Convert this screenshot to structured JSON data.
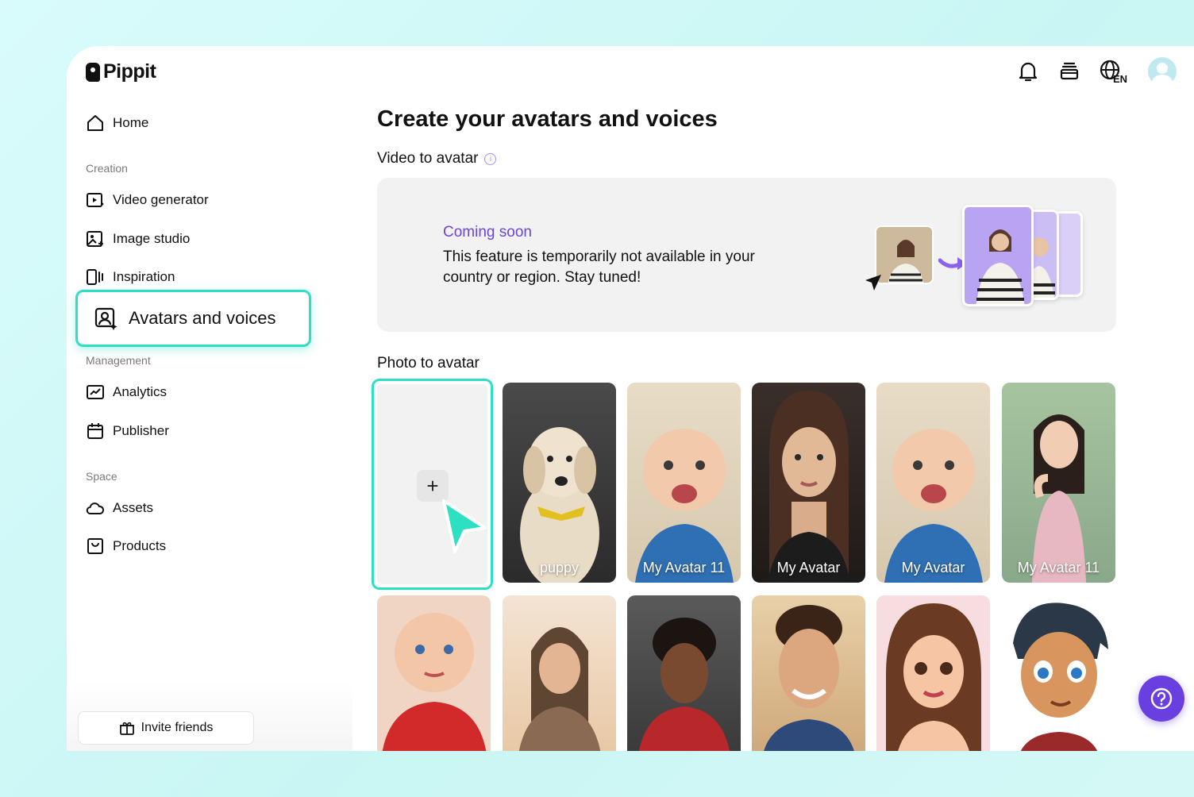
{
  "app": {
    "name": "Pippit"
  },
  "header": {
    "language_badge": "EN"
  },
  "sidebar": {
    "home": "Home",
    "creation_label": "Creation",
    "video_generator": "Video generator",
    "image_studio": "Image studio",
    "inspiration": "Inspiration",
    "avatars_and_voices": "Avatars and voices",
    "management_label": "Management",
    "analytics": "Analytics",
    "publisher": "Publisher",
    "space_label": "Space",
    "assets": "Assets",
    "products": "Products",
    "invite_friends": "Invite friends"
  },
  "main": {
    "title": "Create your avatars and voices",
    "video_to_avatar": "Video to avatar",
    "coming_soon": "Coming soon",
    "unavailable_text": "This feature is temporarily not available in your country or region. Stay tuned!",
    "photo_to_avatar": "Photo to avatar",
    "add_symbol": "+",
    "avatars_row1": [
      {
        "label": "puppy",
        "image": "dog-photo"
      },
      {
        "label": "My Avatar 11",
        "image": "baby-photo"
      },
      {
        "label": "My Avatar",
        "image": "woman-photo"
      },
      {
        "label": "My Avatar",
        "image": "baby-photo"
      },
      {
        "label": "My Avatar 11",
        "image": "woman-pink-dress-photo"
      }
    ],
    "avatars_row2": [
      {
        "image": "baby-red-shirt-photo"
      },
      {
        "image": "woman-sunset-photo"
      },
      {
        "image": "man-curly-hair-photo"
      },
      {
        "image": "man-smiling-photo"
      },
      {
        "image": "cartoon-woman-illustration"
      },
      {
        "image": "cartoon-boy-illustration"
      }
    ]
  },
  "colors": {
    "accent_teal": "#2ee0c2",
    "accent_purple": "#6a3fe0"
  }
}
